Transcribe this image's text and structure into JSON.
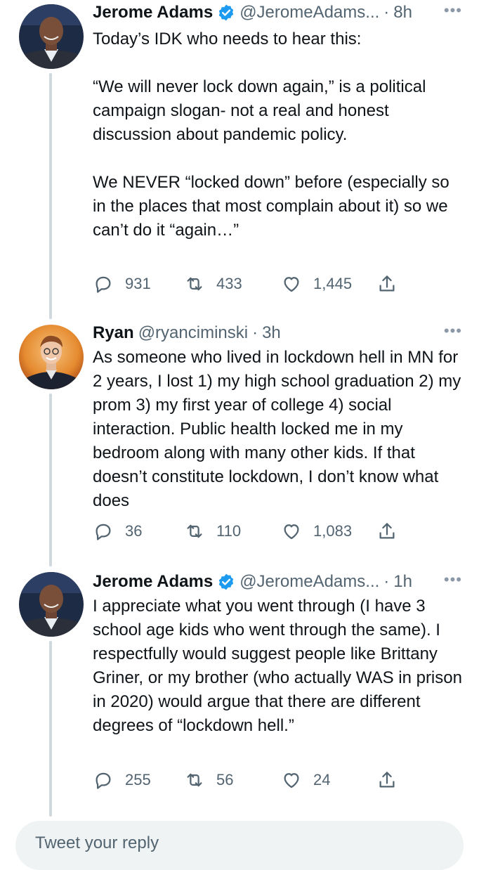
{
  "tweets": [
    {
      "display_name": "Jerome Adams",
      "verified": true,
      "handle": "@JeromeAdams...",
      "separator": "·",
      "time": "8h",
      "more": "•••",
      "paragraphs": [
        "Today’s IDK who needs to hear this:",
        "“We will never lock down again,” is a political campaign slogan- not a real and honest discussion about pandemic policy.",
        "We NEVER “locked down” before (especially so in the places that most complain about it) so we can’t do it “again…”"
      ],
      "counts": {
        "replies": "931",
        "retweets": "433",
        "likes": "1,445"
      },
      "avatar_icon": "avatar-photo"
    },
    {
      "display_name": "Ryan",
      "verified": false,
      "handle": "@ryanciminski",
      "separator": "·",
      "time": "3h",
      "more": "•••",
      "paragraphs": [
        "As someone who lived in lockdown hell in MN for 2 years, I lost 1) my high school graduation 2) my prom 3) my first year of college 4) social interaction. Public health locked me in my bedroom along with many other kids. If that doesn’t constitute lockdown, I don’t know what does"
      ],
      "counts": {
        "replies": "36",
        "retweets": "110",
        "likes": "1,083"
      },
      "avatar_icon": "avatar-photo"
    },
    {
      "display_name": "Jerome Adams",
      "verified": true,
      "handle": "@JeromeAdams...",
      "separator": "·",
      "time": "1h",
      "more": "•••",
      "paragraphs": [
        "I appreciate what you went through (I have 3 school age kids who went through the same). I respectfully would suggest people like Brittany Griner, or my brother (who actually WAS in prison in 2020) would argue that there are different degrees of “lockdown hell.”"
      ],
      "counts": {
        "replies": "255",
        "retweets": "56",
        "likes": "24"
      },
      "avatar_icon": "avatar-photo"
    }
  ],
  "reply_bar": {
    "placeholder": "Tweet your reply"
  },
  "colors": {
    "text": "#0f1419",
    "secondary": "#536471",
    "verified_badge": "#1d9bf0",
    "thread_line": "#cfd9de",
    "reply_bg": "#eff3f4"
  },
  "icons": [
    "reply-icon",
    "retweet-icon",
    "like-icon",
    "share-icon",
    "verified-badge-icon",
    "more-icon"
  ]
}
